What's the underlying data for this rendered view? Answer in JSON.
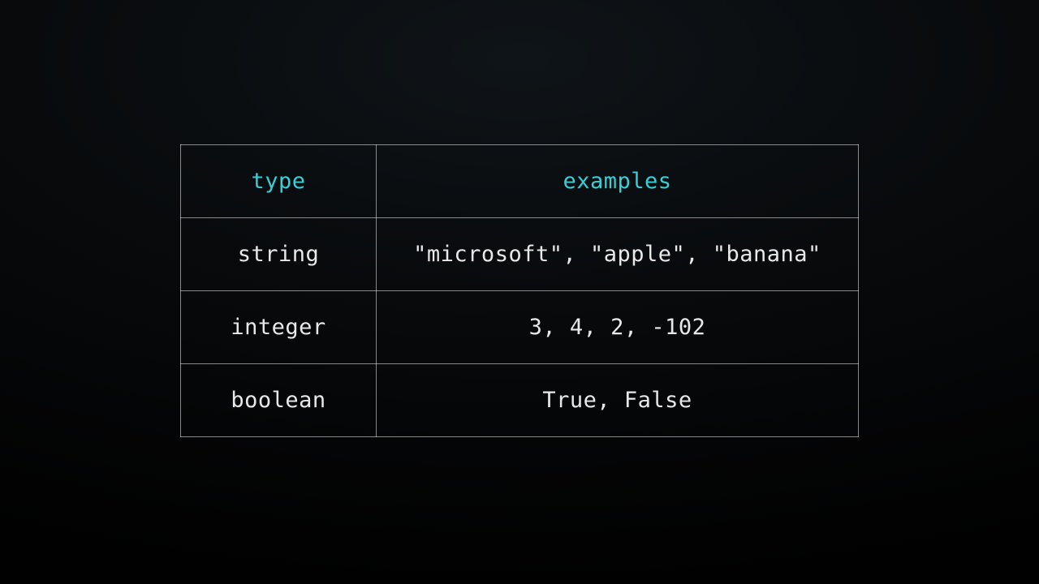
{
  "table": {
    "headers": [
      "type",
      "examples"
    ],
    "rows": [
      {
        "type": "string",
        "examples": "\"microsoft\", \"apple\", \"banana\""
      },
      {
        "type": "integer",
        "examples": "3, 4, 2, -102"
      },
      {
        "type": "boolean",
        "examples": "True, False"
      }
    ]
  }
}
